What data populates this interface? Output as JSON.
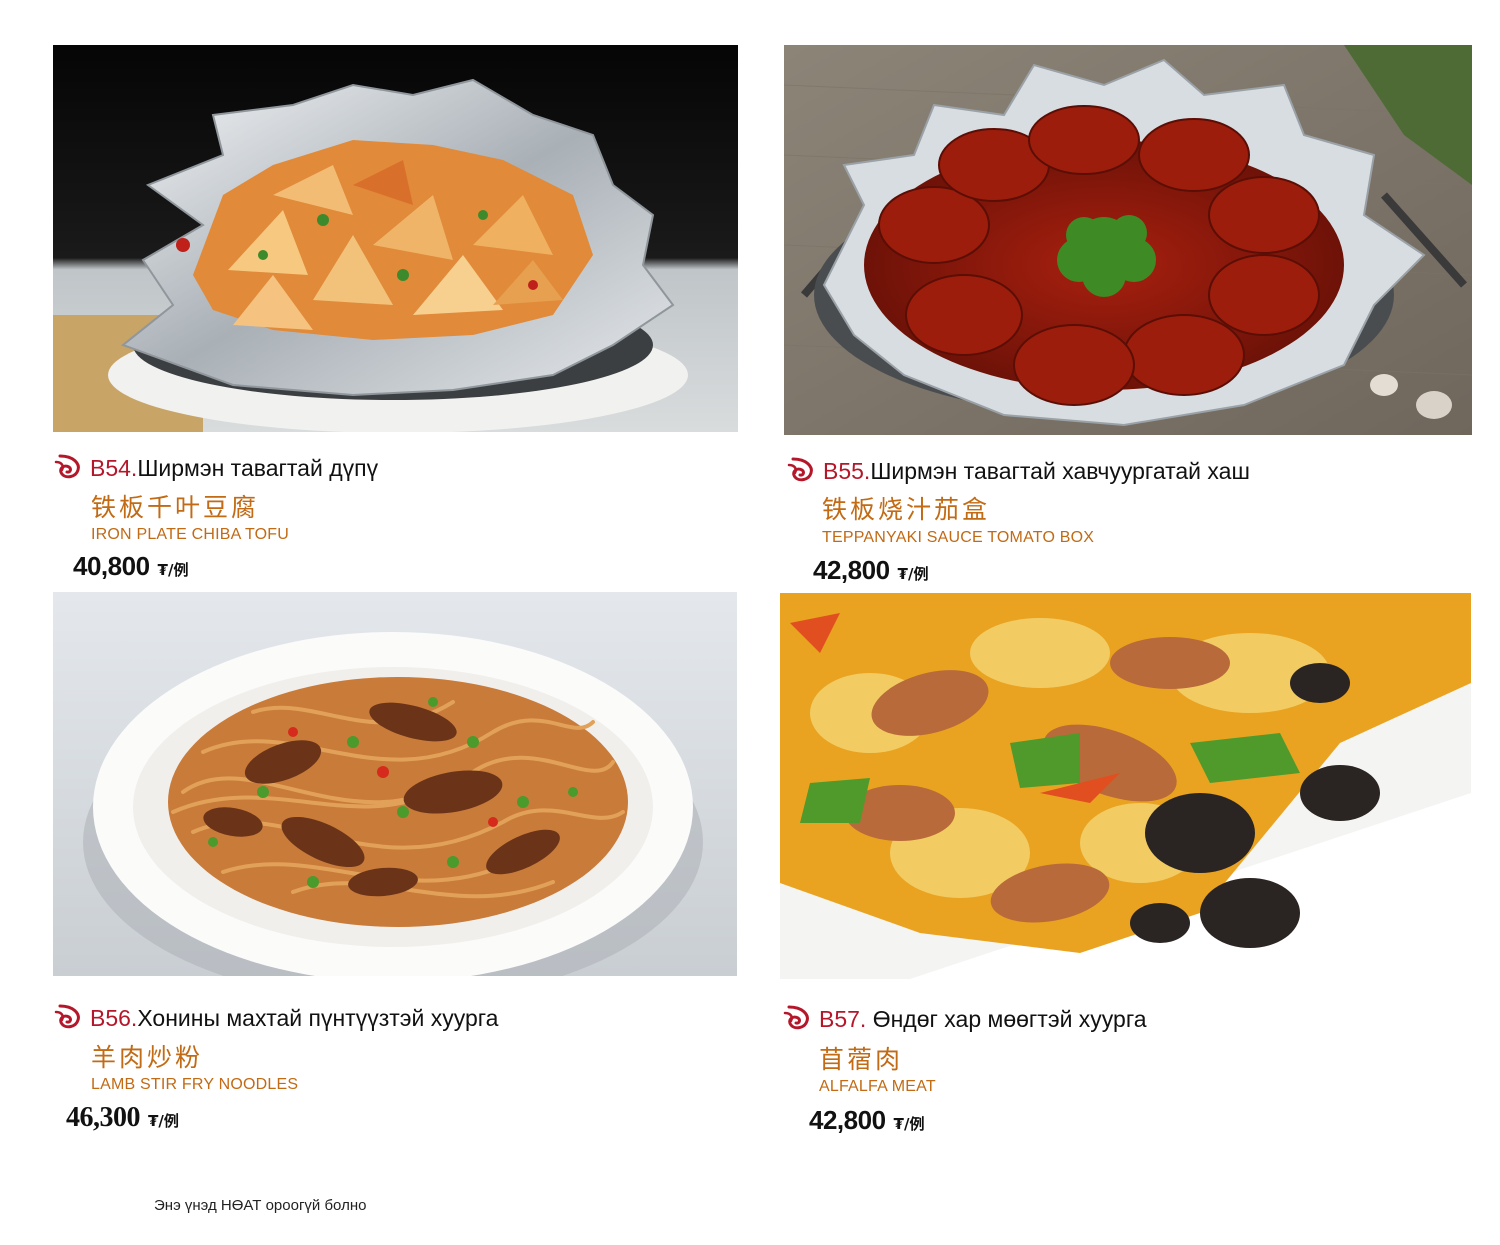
{
  "items": [
    {
      "code": "B54.",
      "name_mn": "Ширмэн тавагтай дүпү",
      "name_zh": "铁板千叶豆腐",
      "name_en": "IRON PLATE CHIBA TOFU",
      "price": "40,800",
      "unit": "₮/例",
      "photo": "iron-plate-tofu-photo"
    },
    {
      "code": "B55.",
      "name_mn": "Ширмэн тавагтай хавчуургатай хаш",
      "name_zh": "铁板烧汁茄盒",
      "name_en": "TEPPANYAKI SAUCE TOMATO BOX",
      "price": "42,800",
      "unit": "₮/例",
      "photo": "teppanyaki-eggplant-photo"
    },
    {
      "code": "B56.",
      "name_mn": "Хонины махтай пүнтүүзтэй хуурга",
      "name_zh": "羊肉炒粉",
      "name_en": "LAMB STIR FRY NOODLES",
      "price": "46,300",
      "unit": "₮/例",
      "photo": "lamb-noodles-photo"
    },
    {
      "code": "B57.",
      "name_mn": " Өндөг хар мөөгтэй хуурга",
      "name_zh": "苜蓿肉",
      "name_en": "ALFALFA MEAT",
      "price": "42,800",
      "unit": "₮/例",
      "photo": "alfalfa-meat-photo"
    }
  ],
  "footnote": "Энэ үнэд НӨАТ ороогүй болно",
  "colors": {
    "code_red": "#b5172a",
    "chinese_orange": "#c26a14",
    "text": "#111111"
  },
  "icons": {
    "bullet": "swirl-bullet-icon"
  }
}
